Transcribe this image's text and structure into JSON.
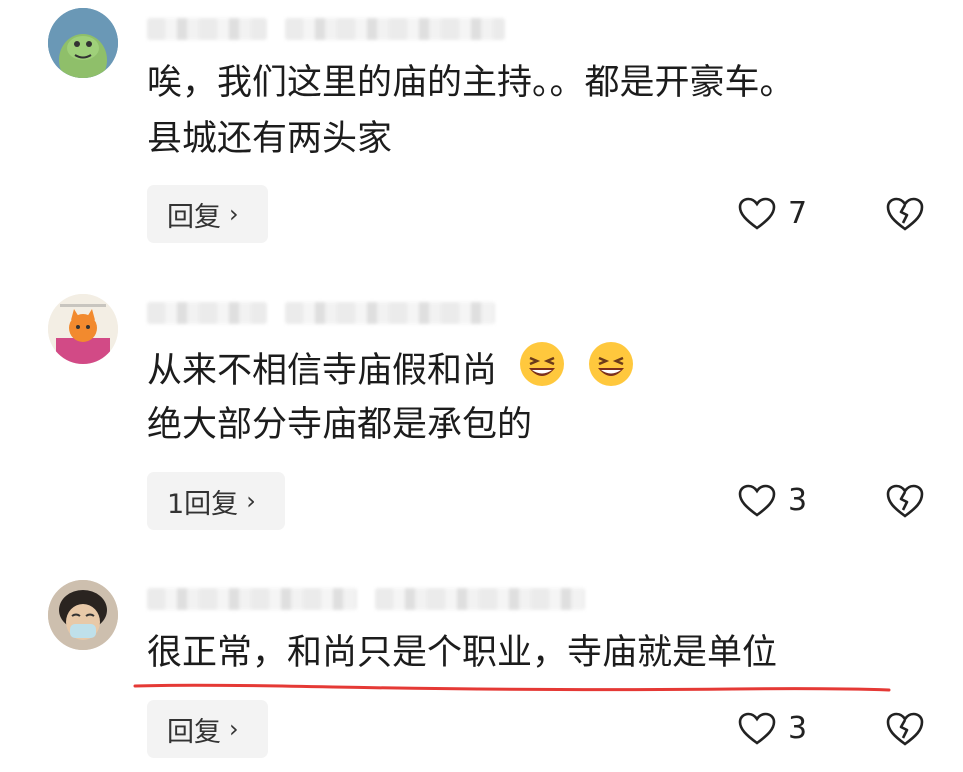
{
  "comments": [
    {
      "lines": [
        "唉，我们这里的庙的主持。。都是开豪车。",
        "县城还有两头家"
      ],
      "reply_label": "回复",
      "likes": "7"
    },
    {
      "lines": [
        "从来不相信寺庙假和尚",
        "绝大部分寺庙都是承包的"
      ],
      "reply_label": "1回复",
      "likes": "3",
      "emoji": [
        "grinning-squint-emoji",
        "grinning-squint-emoji"
      ]
    },
    {
      "lines": [
        "很正常，和尚只是个职业，寺庙就是单位"
      ],
      "reply_label": "回复",
      "likes": "3",
      "highlight": "red-underline"
    }
  ],
  "icons": {
    "chevron": "›",
    "like": "heart-outline-icon",
    "dislike": "broken-heart-icon"
  },
  "colors": {
    "underline": "#e53935",
    "reply_bg": "#f3f3f3"
  }
}
